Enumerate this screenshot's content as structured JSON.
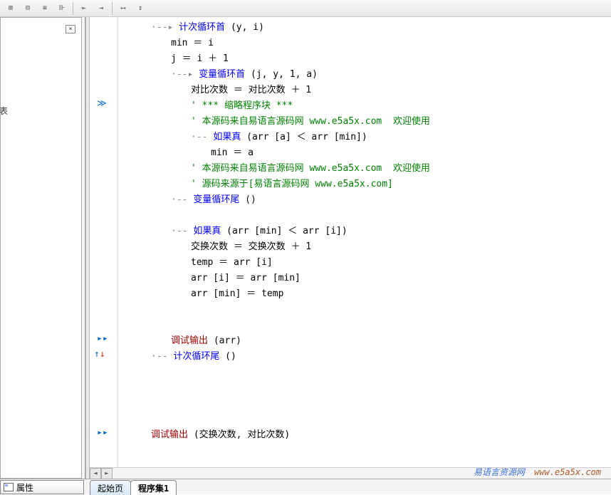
{
  "toolbar": {
    "buttons": [
      "btn1",
      "btn2",
      "btn3",
      "btn4",
      "btn5",
      "btn6",
      "btn7",
      "btn8"
    ]
  },
  "left_panel": {
    "side_text": "表"
  },
  "code": {
    "lines": [
      {
        "indent": 1,
        "guide": "·--▸",
        "parts": [
          {
            "cls": "kw-blue",
            "t": "计次循环首"
          },
          {
            "cls": "kw-black",
            "t": " (y, i)"
          }
        ]
      },
      {
        "indent": 2,
        "guide": "",
        "parts": [
          {
            "cls": "kw-black",
            "t": "min ＝ i"
          }
        ]
      },
      {
        "indent": 2,
        "guide": "",
        "parts": [
          {
            "cls": "kw-black",
            "t": "j ＝ i ＋ 1"
          }
        ]
      },
      {
        "indent": 2,
        "guide": "·--▸",
        "parts": [
          {
            "cls": "kw-blue",
            "t": "变量循环首"
          },
          {
            "cls": "kw-black",
            "t": " (j, y, 1, a)"
          }
        ]
      },
      {
        "indent": 3,
        "guide": "",
        "parts": [
          {
            "cls": "kw-black",
            "t": "对比次数 ＝ 对比次数 ＋ 1"
          }
        ]
      },
      {
        "indent": 3,
        "guide": "",
        "parts": [
          {
            "cls": "kw-green",
            "t": "' *** 缩略程序块 ***"
          }
        ],
        "gutter": "≫"
      },
      {
        "indent": 3,
        "guide": "",
        "parts": [
          {
            "cls": "kw-green",
            "t": "' 本源码来自易语言源码网 www.e5a5x.com  欢迎使用"
          }
        ]
      },
      {
        "indent": 3,
        "guide": "·--",
        "parts": [
          {
            "cls": "kw-blue",
            "t": "如果真"
          },
          {
            "cls": "kw-black",
            "t": " (arr [a] ＜ arr [min])"
          }
        ]
      },
      {
        "indent": 4,
        "guide": "",
        "parts": [
          {
            "cls": "kw-black",
            "t": "min ＝ a"
          }
        ]
      },
      {
        "indent": 3,
        "guide": "",
        "parts": [
          {
            "cls": "kw-green",
            "t": "' 本源码来自易语言源码网 www.e5a5x.com  欢迎使用"
          }
        ]
      },
      {
        "indent": 3,
        "guide": "",
        "parts": [
          {
            "cls": "kw-green",
            "t": "' 源码来源于[易语言源码网 www.e5a5x.com]"
          }
        ]
      },
      {
        "indent": 2,
        "guide": "·--",
        "parts": [
          {
            "cls": "kw-blue",
            "t": "变量循环尾"
          },
          {
            "cls": "kw-black",
            "t": " ()"
          }
        ]
      },
      {
        "indent": 0,
        "guide": "",
        "parts": [
          {
            "cls": "kw-black",
            "t": ""
          }
        ]
      },
      {
        "indent": 2,
        "guide": "·--",
        "parts": [
          {
            "cls": "kw-blue",
            "t": "如果真"
          },
          {
            "cls": "kw-black",
            "t": " (arr [min] ＜ arr [i])"
          }
        ]
      },
      {
        "indent": 3,
        "guide": "",
        "parts": [
          {
            "cls": "kw-black",
            "t": "交换次数 ＝ 交换次数 ＋ 1"
          }
        ]
      },
      {
        "indent": 3,
        "guide": "",
        "parts": [
          {
            "cls": "kw-black",
            "t": "temp ＝ arr [i]"
          }
        ]
      },
      {
        "indent": 3,
        "guide": "",
        "parts": [
          {
            "cls": "kw-black",
            "t": "arr [i] ＝ arr [min]"
          }
        ]
      },
      {
        "indent": 3,
        "guide": "",
        "parts": [
          {
            "cls": "kw-black",
            "t": "arr [min] ＝ temp"
          }
        ]
      },
      {
        "indent": 0,
        "guide": "",
        "parts": [
          {
            "cls": "kw-black",
            "t": ""
          }
        ]
      },
      {
        "indent": 0,
        "guide": "",
        "parts": [
          {
            "cls": "kw-black",
            "t": ""
          }
        ]
      },
      {
        "indent": 2,
        "guide": "",
        "parts": [
          {
            "cls": "kw-red",
            "t": "调试输出"
          },
          {
            "cls": "kw-black",
            "t": " (arr)"
          }
        ],
        "gutter": "▸▸"
      },
      {
        "indent": 1,
        "guide": "·--",
        "parts": [
          {
            "cls": "kw-blue",
            "t": "计次循环尾"
          },
          {
            "cls": "kw-black",
            "t": " ()"
          }
        ],
        "gutter": "↑↓",
        "cursor": true
      },
      {
        "indent": 0,
        "guide": "",
        "parts": [
          {
            "cls": "kw-black",
            "t": ""
          }
        ]
      },
      {
        "indent": 0,
        "guide": "",
        "parts": [
          {
            "cls": "kw-black",
            "t": ""
          }
        ]
      },
      {
        "indent": 0,
        "guide": "",
        "parts": [
          {
            "cls": "kw-black",
            "t": ""
          }
        ]
      },
      {
        "indent": 0,
        "guide": "",
        "parts": [
          {
            "cls": "kw-black",
            "t": ""
          }
        ]
      },
      {
        "indent": 1,
        "guide": "",
        "parts": [
          {
            "cls": "kw-red",
            "t": "调试输出"
          },
          {
            "cls": "kw-black",
            "t": " (交换次数, 对比次数)"
          }
        ],
        "gutter": "▸▸"
      }
    ]
  },
  "bottom": {
    "properties_label": "属性",
    "tabs": [
      {
        "label": "起始页",
        "active": false
      },
      {
        "label": "程序集1",
        "active": true
      }
    ]
  },
  "watermark": {
    "text1": "易语言资源网",
    "text2": "www.e5a5x.com"
  }
}
